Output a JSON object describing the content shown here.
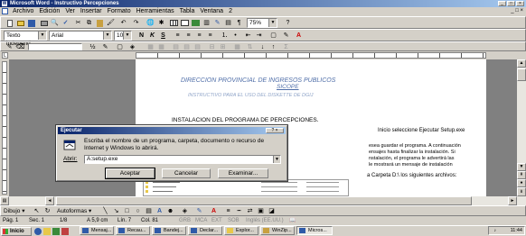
{
  "titlebar": {
    "title": "Microsoft Word - Instructivo Percepciones",
    "controls": [
      "_",
      "□",
      "×"
    ],
    "doc_controls": "_ □ ×"
  },
  "menu": [
    "Archivo",
    "Edición",
    "Ver",
    "Insertar",
    "Formato",
    "Herramientas",
    "Tabla",
    "Ventana",
    "2"
  ],
  "toolbar_standard": {
    "zoom": "75%"
  },
  "toolbar_format": {
    "style": "Texto independ",
    "font": "Arial",
    "size": "10"
  },
  "document": {
    "header_title": "DIRECCION PROVINCIAL DE INGRESOS PUBLICOS",
    "header_sub": "SICOPE",
    "header_line2": "INSTRUCTIVO PARA EL USO DEL DISKETTE DE DGIJ",
    "section_heading": "INSTALACION DEL PROGRAMA DE PERCEPCIONES.",
    "para_right_1": "Inicio seleccione Ejecutar Setup.exe",
    "para_right_2a": "esea guardar el programa. A continuación",
    "para_right_2b": "ensajes hasta finalizar la instalación. Si",
    "para_right_2c": "nstalación, el programa le advertirá las",
    "para_right_2d": "le mostrará un mensaje de instalación",
    "para_right_3": "a Carpeta D:\\ los siguientes archivos:"
  },
  "dialog": {
    "title": "Ejecutar",
    "title_buttons": "? ×",
    "message": "Escriba el nombre de un programa, carpeta, documento o recurso de Internet y Windows lo abrirá.",
    "open_label": "Abrir:",
    "open_value": "A:setup.exe",
    "buttons": {
      "ok": "Aceptar",
      "cancel": "Cancelar",
      "browse": "Examinar..."
    }
  },
  "drawing_toolbar": {
    "draw": "Dibujo",
    "autoshapes": "Autoformas"
  },
  "statusbar": {
    "page": "Pág.",
    "page_num": "1",
    "section": "Sec.",
    "section_num": "1",
    "pages": "1/8",
    "at": "A",
    "at_value": "5,9 cm",
    "line": "Lín.",
    "line_num": "7",
    "col": "Col.",
    "col_num": "81",
    "modes": [
      "GRB",
      "MCA",
      "EXT",
      "SOB"
    ],
    "lang": "Inglés (EE.UU.)"
  },
  "taskbar": {
    "start": "Inicio",
    "tasks": [
      "Mensaj...",
      "Recau...",
      "Bandej...",
      "Declar...",
      "Explor...",
      "WinZip...",
      "Micros..."
    ],
    "clock": "11:44"
  },
  "colors": {
    "titlebar_start": "#0a246a",
    "titlebar_end": "#a6caf0",
    "chrome": "#d4d0c8",
    "workspace": "#808080",
    "doc_header": "#4f6ea8"
  }
}
